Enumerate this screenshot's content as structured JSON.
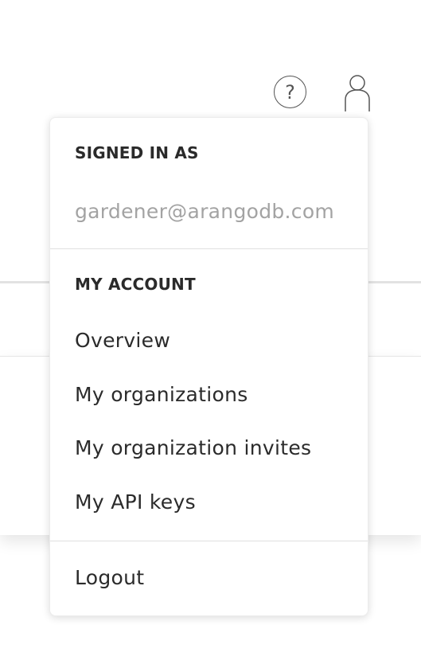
{
  "header": {
    "help_icon": "help-circle-icon",
    "help_glyph": "?",
    "user_icon": "user-icon"
  },
  "user_menu": {
    "signed_in_heading": "SIGNED IN AS",
    "email": "gardener@arangodb.com",
    "account_heading": "MY ACCOUNT",
    "items": [
      {
        "label": "Overview"
      },
      {
        "label": "My organizations"
      },
      {
        "label": "My organization invites"
      },
      {
        "label": "My API keys"
      }
    ],
    "logout_label": "Logout"
  }
}
